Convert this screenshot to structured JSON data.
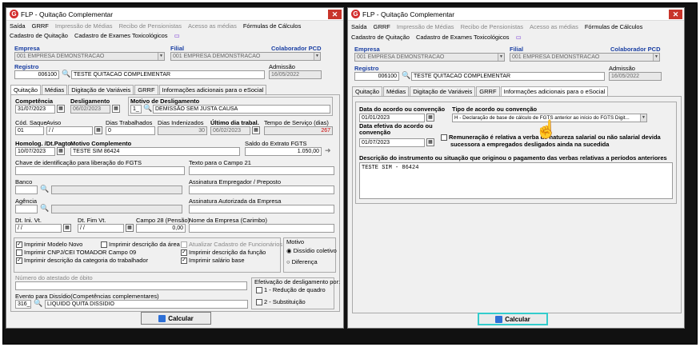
{
  "left": {
    "title": "FLP - Quitação Complementar",
    "menu": [
      "Saída",
      "GRRF",
      "Impressão de Médias",
      "Recibo de Pensionistas",
      "Acesso as médias",
      "Fórmulas de Cálculos"
    ],
    "menu2": [
      "Cadastro de Quitação",
      "Cadastro de Exames Toxicológicos"
    ],
    "empresa_label": "Empresa",
    "empresa_value": "001 EMPRESA DEMONSTRACAO",
    "filial_label": "Filial",
    "filial_value": "001 EMPRESA DEMONSTRACAO",
    "pcd_label": "Colaborador PCD",
    "registro_label": "Registro",
    "registro_value": "006100",
    "nome_value": "TESTE QUITACAO COMPLEMENTAR",
    "admissao_label": "Admissão",
    "admissao_value": "16/05/2022",
    "tabs": [
      "Quitação",
      "Médias",
      "Digitação de Variáveis",
      "GRRF",
      "Informações adicionais para o eSocial"
    ],
    "competencia_label": "Competência",
    "competencia_value": "31/07/2023",
    "desligamento_label": "Desligamento",
    "desligamento_value": "06/02/2023",
    "motivo_label": "Motivo de Desligamento",
    "motivo_code": "1_",
    "motivo_value": "DEMISSÃO SEM JUSTA CAUSA",
    "saque_label": "Cód. Saque",
    "saque_value": "01",
    "aviso_label": "Aviso",
    "aviso_value": "/ /",
    "dias_trab_label": "Dias Trabalhados",
    "dias_trab_value": "0",
    "dias_ind_label": "Dias Indenizados",
    "dias_ind_value": "30",
    "ultimo_label": "Último dia trabal.",
    "ultimo_value": "06/02/2023",
    "tempo_label": "Tempo de Serviço (dias)",
    "tempo_value": "267",
    "homolog_label": "Homolog. /Dt.Pagto",
    "homolog_value": "10/07/2023",
    "motivo_compl_label": "Motivo Complemento",
    "motivo_compl_value": "TESTE SIM 86424",
    "saldo_label": "Saldo do Extrato FGTS",
    "saldo_value": "1.050,00",
    "chave_label": "Chave de identificação para liberação do FGTS",
    "texto21_label": "Texto para o Campo 21",
    "banco_label": "Banco",
    "assinatura_emp_label": "Assinatura Empregador / Preposto",
    "agencia_label": "Agência",
    "assinatura_aut_label": "Assinatura Autorizada da Empresa",
    "dtini_label": "Dt. Ini. Vt.",
    "dtini_value": "/ /",
    "dtfim_label": "Dt. Fim Vt.",
    "dtfim_value": "/ /",
    "campo28_label": "Campo 28 (Pensão)",
    "campo28_value": "0,00",
    "nome_empresa_label": "Nome da Empresa (Carimbo)",
    "cb": [
      "Imprimir Modelo Novo",
      "Imprimir descrição da área",
      "Atualizar Cadastro de Funcionários",
      "Imprimir CNPJ/CEI TOMADOR Campo 09",
      "Imprimir descrição da função",
      "Imprimir descrição da categoria do trabalhador",
      "Imprimir salário base"
    ],
    "motivo_grp": "Motivo",
    "radio1": "Dissídio coletivo",
    "radio2": "Diferença",
    "obito_label": "Número do atestado de óbito",
    "evento_label": "Evento para Dissídio(Competências complementares)",
    "evento_code": "316_",
    "evento_value": "LIQUIDO QUITA DISSIDIO",
    "efet_label": "Efetivação de desligamento por:",
    "efet1": "1 - Redução de quadro",
    "efet2": "2 - Substituição",
    "calcular": "Calcular"
  },
  "right": {
    "title": "FLP - Quitação Complementar",
    "menu": [
      "Saída",
      "GRRF",
      "Impressão de Médias",
      "Recibo de Pensionistas",
      "Acesso as médias",
      "Fórmulas de Cálculos"
    ],
    "menu2": [
      "Cadastro de Quitação",
      "Cadastro de Exames Toxicológicos"
    ],
    "empresa_label": "Empresa",
    "empresa_value": "001 EMPRESA DEMONSTRACAO",
    "filial_label": "Filial",
    "filial_value": "001 EMPRESA DEMONSTRACAO",
    "pcd_label": "Colaborador PCD",
    "registro_label": "Registro",
    "registro_value": "006100",
    "nome_value": "TESTE QUITACAO COMPLEMENTAR",
    "admissao_label": "Admissão",
    "admissao_value": "16/05/2022",
    "tabs": [
      "Quitação",
      "Médias",
      "Digitação de Variáveis",
      "GRRF",
      "Informações adicionais para o eSocial"
    ],
    "data_acordo_label": "Data do acordo ou convenção",
    "data_acordo_value": "01/01/2023",
    "tipo_label": "Tipo de acordo ou convenção",
    "tipo_value": "H - Declaração de base de cálculo de FGTS anterior ao início do FGTS Digit...",
    "data_efet_label1": "Data efetiva do acordo ou",
    "data_efet_label2": "convenção",
    "data_efet_value": "01/07/2023",
    "remun_text1": "Remuneração é relativa a verba de natureza salarial ou não salarial devida",
    "remun_text2": "sucessora a empregados desligados ainda na sucedida",
    "desc_label": "Descrição do instrumento ou situação que originou o pagamento das verbas relativas a períodos anteriores",
    "desc_value": "TESTE SIM - 86424",
    "calcular": "Calcular"
  }
}
